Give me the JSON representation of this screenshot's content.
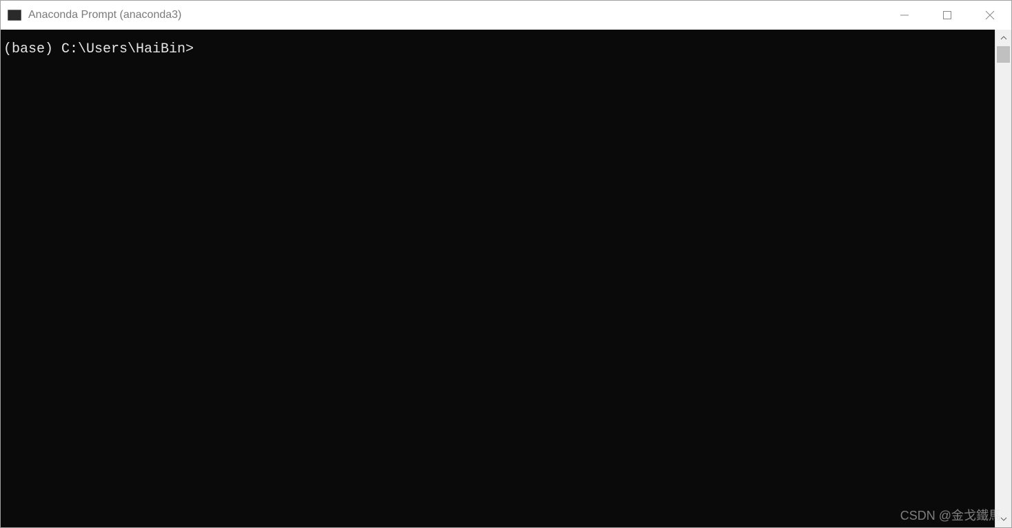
{
  "window": {
    "title": "Anaconda Prompt (anaconda3)"
  },
  "terminal": {
    "prompt": "(base) C:\\Users\\HaiBin>"
  },
  "watermark": {
    "text": "CSDN @金戈鐵馬"
  }
}
